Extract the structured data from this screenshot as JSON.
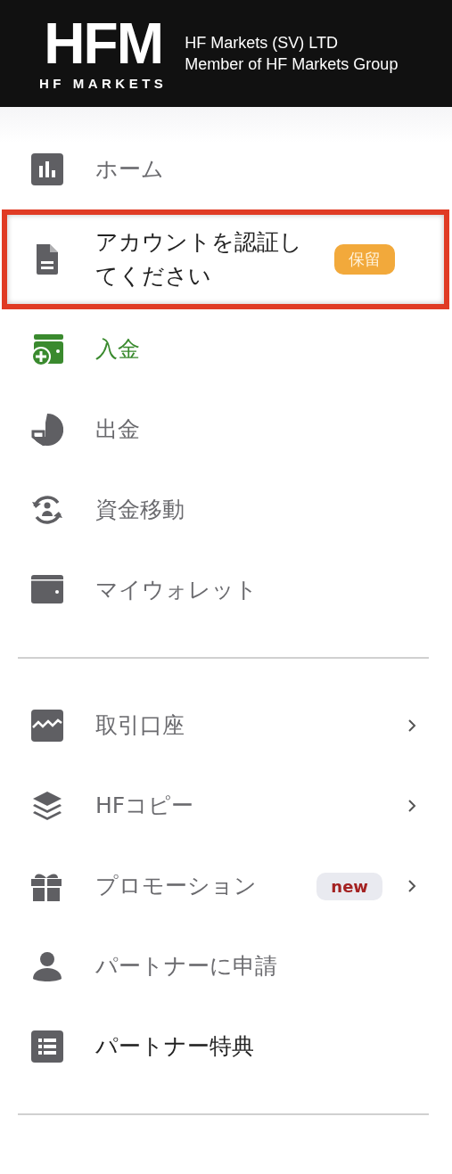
{
  "header": {
    "logo_mark": "HFM",
    "logo_wordmark": "HF MARKETS",
    "company_line_1": "HF Markets (SV) LTD",
    "company_line_2": "Member of HF Markets Group"
  },
  "sections": [
    {
      "items": [
        {
          "kind": "chart",
          "label": "ホーム",
          "selected": false,
          "emphasis": false,
          "flagged": false,
          "has_submenu": false
        },
        {
          "kind": "document",
          "label": "アカウントを認証してください",
          "selected": false,
          "emphasis": true,
          "flagged": true,
          "has_submenu": false,
          "badge": {
            "text": "保留",
            "kind": "pending"
          }
        },
        {
          "kind": "wallet-plus",
          "label": "入金",
          "selected": true,
          "emphasis": false,
          "flagged": false,
          "has_submenu": false
        },
        {
          "kind": "pie",
          "label": "出金",
          "selected": false,
          "emphasis": false,
          "flagged": false,
          "has_submenu": false
        },
        {
          "kind": "transfer",
          "label": "資金移動",
          "selected": false,
          "emphasis": false,
          "flagged": false,
          "has_submenu": false
        },
        {
          "kind": "wallet",
          "label": "マイウォレット",
          "selected": false,
          "emphasis": false,
          "flagged": false,
          "has_submenu": false
        }
      ]
    },
    {
      "items": [
        {
          "kind": "trading",
          "label": "取引口座",
          "selected": false,
          "emphasis": false,
          "flagged": false,
          "has_submenu": true
        },
        {
          "kind": "layers",
          "label": "HFコピー",
          "selected": false,
          "emphasis": false,
          "flagged": false,
          "has_submenu": true
        },
        {
          "kind": "gift",
          "label": "プロモーション",
          "selected": false,
          "emphasis": false,
          "flagged": false,
          "has_submenu": true,
          "badge": {
            "text": "new",
            "kind": "new"
          }
        },
        {
          "kind": "person",
          "label": "パートナーに申請",
          "selected": false,
          "emphasis": false,
          "flagged": false,
          "has_submenu": false
        },
        {
          "kind": "list",
          "label": "パートナー特典",
          "selected": false,
          "emphasis": true,
          "flagged": false,
          "has_submenu": false
        }
      ]
    }
  ]
}
